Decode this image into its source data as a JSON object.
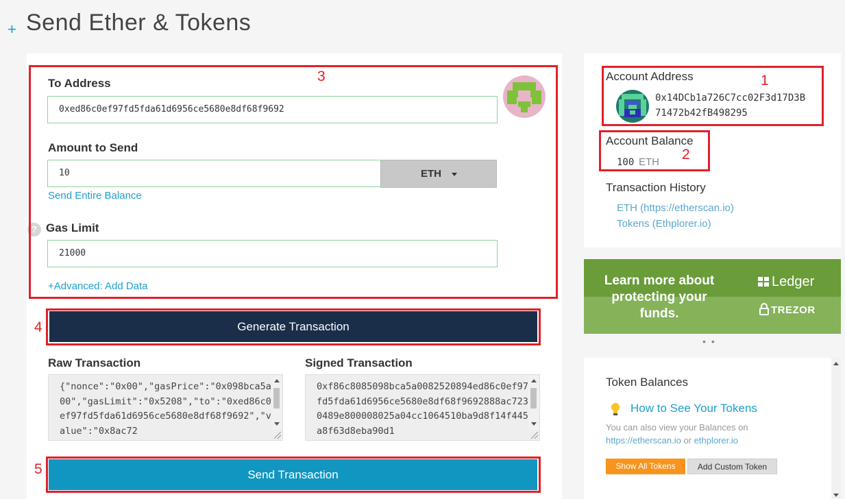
{
  "page": {
    "plus": "+",
    "title": "Send Ether & Tokens"
  },
  "form": {
    "to_address_label": "To Address",
    "to_address_value": "0xed86c0ef97fd5fda61d6956ce5680e8df68f9692",
    "amount_label": "Amount to Send",
    "amount_value": "10",
    "token_selected": "ETH",
    "send_entire_balance": "Send Entire Balance",
    "gas_limit_label": "Gas Limit",
    "gas_limit_value": "21000",
    "help_icon": "?",
    "advanced_link": "+Advanced: Add Data",
    "generate_button": "Generate Transaction",
    "raw_label": "Raw Transaction",
    "raw_value": "{\"nonce\":\"0x00\",\"gasPrice\":\"0x098bca5a00\",\"gasLimit\":\"0x5208\",\"to\":\"0xed86c0ef97fd5fda61d6956ce5680e8df68f9692\",\"value\":\"0x8ac72",
    "signed_label": "Signed Transaction",
    "signed_value": "0xf86c8085098bca5a0082520894ed86c0ef97fd5fda61d6956ce5680e8df68f9692888ac7230489e800008025a04cc1064510ba9d8f14f445a8f63d8eba90d1",
    "send_button": "Send Transaction"
  },
  "annotations": {
    "n1": "1",
    "n2": "2",
    "n3": "3",
    "n4": "4",
    "n5": "5",
    "color": "#e0202a"
  },
  "account": {
    "address_label": "Account Address",
    "address_line1": "0x14DCb1a726C7cc02F3d17D3B",
    "address_line2": "71472b42fB498295",
    "balance_label": "Account Balance",
    "balance_value": "100",
    "balance_unit": "ETH",
    "history_label": "Transaction History",
    "history_eth": "ETH (https://etherscan.io)",
    "history_tokens": "Tokens (Ethplorer.io)"
  },
  "ad": {
    "text": "Learn more about protecting your funds.",
    "ledger": "Ledger",
    "trezor": "TREZOR"
  },
  "tokens": {
    "title": "Token Balances",
    "howto": "How to See Your Tokens",
    "desc_line1": "You can also view your Balances on",
    "desc_link1": "https://etherscan.io",
    "desc_or": " or ",
    "desc_link2": "ethplorer.io",
    "show_all": "Show All Tokens",
    "add_custom": "Add Custom Token"
  },
  "colors": {
    "accent": "#1e9fcb",
    "navy": "#1a2e4a",
    "send_blue": "#1196c1",
    "orange": "#f7941d",
    "input_border": "#8fd39a"
  }
}
